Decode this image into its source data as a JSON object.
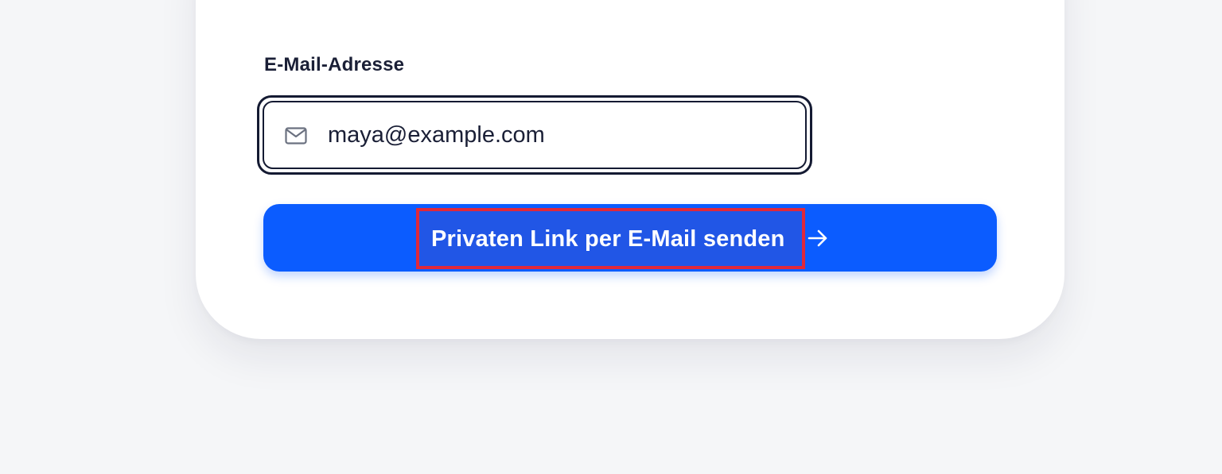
{
  "form": {
    "email_label": "E-Mail-Adresse",
    "email_value": "maya@example.com",
    "email_icon": "mail-icon",
    "submit_label": "Privaten Link per E-Mail senden",
    "submit_icon": "arrow-right-icon"
  },
  "colors": {
    "page_background": "#f5f6f8",
    "card_background": "#ffffff",
    "accent": "#0b5cff",
    "text": "#1a1f36",
    "highlight_border": "#e0283a"
  }
}
